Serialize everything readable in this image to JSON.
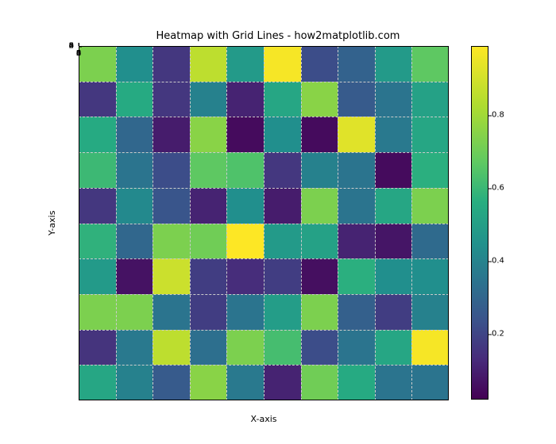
{
  "chart_data": {
    "type": "heatmap",
    "title": "Heatmap with Grid Lines - how2matplotlib.com",
    "xlabel": "X-axis",
    "ylabel": "Y-axis",
    "colormap": "viridis",
    "rows": 10,
    "cols": 10,
    "x_ticks": [
      0,
      2,
      4,
      6,
      8
    ],
    "y_ticks": [
      0,
      2,
      4,
      6,
      8
    ],
    "colorbar_ticks": [
      0.2,
      0.4,
      0.6,
      0.8
    ],
    "vmin": 0.02,
    "vmax": 0.99,
    "values": [
      [
        0.8,
        0.5,
        0.18,
        0.9,
        0.55,
        0.98,
        0.25,
        0.33,
        0.55,
        0.75
      ],
      [
        0.18,
        0.62,
        0.18,
        0.45,
        0.12,
        0.6,
        0.82,
        0.3,
        0.4,
        0.58
      ],
      [
        0.62,
        0.35,
        0.1,
        0.82,
        0.05,
        0.5,
        0.05,
        0.95,
        0.42,
        0.6
      ],
      [
        0.68,
        0.4,
        0.25,
        0.75,
        0.72,
        0.18,
        0.45,
        0.4,
        0.05,
        0.64
      ],
      [
        0.18,
        0.48,
        0.28,
        0.12,
        0.5,
        0.1,
        0.8,
        0.4,
        0.6,
        0.8
      ],
      [
        0.65,
        0.35,
        0.8,
        0.78,
        0.99,
        0.55,
        0.58,
        0.12,
        0.08,
        0.36
      ],
      [
        0.55,
        0.07,
        0.92,
        0.2,
        0.15,
        0.2,
        0.06,
        0.64,
        0.5,
        0.5
      ],
      [
        0.8,
        0.8,
        0.4,
        0.2,
        0.4,
        0.56,
        0.8,
        0.32,
        0.2,
        0.45
      ],
      [
        0.17,
        0.42,
        0.9,
        0.38,
        0.8,
        0.7,
        0.25,
        0.4,
        0.6,
        0.98
      ],
      [
        0.6,
        0.45,
        0.3,
        0.82,
        0.42,
        0.12,
        0.78,
        0.62,
        0.4,
        0.4
      ]
    ]
  },
  "cb_labels": {
    "t0": "0.2",
    "t1": "0.4",
    "t2": "0.6",
    "t3": "0.8"
  },
  "xt_labels": {
    "t0": "0",
    "t1": "2",
    "t2": "4",
    "t3": "6",
    "t4": "8"
  },
  "yt_labels": {
    "t0": "0",
    "t1": "2",
    "t2": "4",
    "t3": "6",
    "t4": "8"
  }
}
